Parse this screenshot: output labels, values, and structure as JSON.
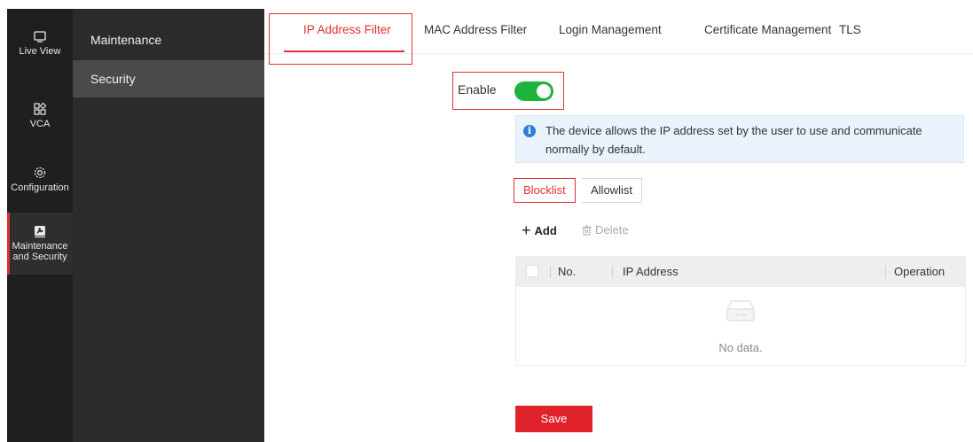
{
  "rail": {
    "items": [
      {
        "label": "Live View",
        "icon": "monitor-icon"
      },
      {
        "label": "VCA",
        "icon": "grid-icon"
      },
      {
        "label": "Configuration",
        "icon": "gear-icon"
      },
      {
        "label_line1": "Maintenance",
        "label_line2": "and Security",
        "icon": "wrench-icon",
        "active": true
      }
    ]
  },
  "submenu": {
    "items": [
      {
        "label": "Maintenance"
      },
      {
        "label": "Security",
        "active": true
      }
    ]
  },
  "tabs": [
    {
      "label": "IP Address Filter",
      "active": true
    },
    {
      "label": "MAC Address Filter"
    },
    {
      "label": "Login Management"
    },
    {
      "label": "Certificate Management"
    },
    {
      "label": "TLS"
    }
  ],
  "enable": {
    "label": "Enable",
    "value": true
  },
  "info": {
    "icon": "info-icon",
    "line1": "The device allows the IP address set by the user to use and communicate",
    "line2": "normally by default."
  },
  "list_switch": {
    "blocklist": "Blocklist",
    "allowlist": "Allowlist",
    "selected": "Blocklist"
  },
  "actions": {
    "add": "Add",
    "delete": "Delete"
  },
  "table": {
    "columns": [
      "No.",
      "IP Address",
      "Operation"
    ],
    "rows": [],
    "empty_text": "No data."
  },
  "save_label": "Save",
  "colors": {
    "accent": "#e03131",
    "toggle_on": "#1eb33f",
    "rail_bg": "#1f1f1f",
    "submenu_bg": "#2b2b2b",
    "info_bg": "#eaf2fb"
  }
}
